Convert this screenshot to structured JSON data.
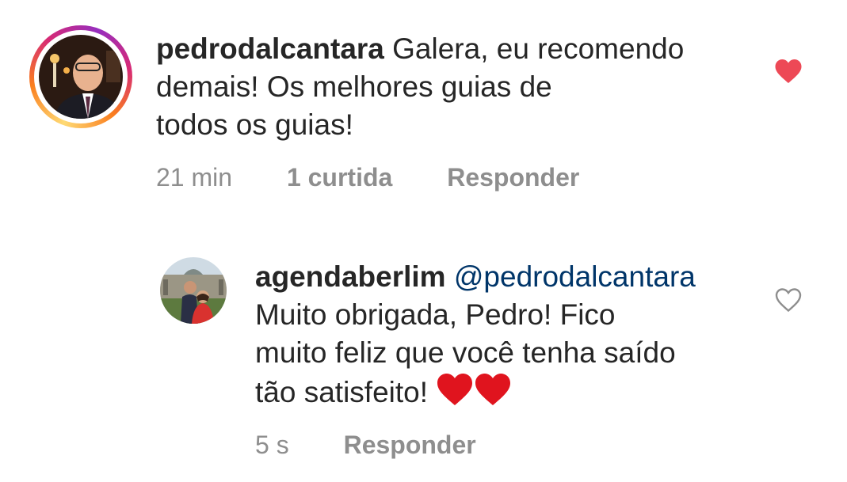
{
  "comments": [
    {
      "username": "pedrodalcantara",
      "text": "Galera, eu recomendo demais! Os melhores guias de todos os guias!",
      "line1": "Galera, eu recomendo",
      "line2": "demais! Os melhores guias de",
      "line3": "todos os guias!",
      "time": "21 min",
      "likes": "1 curtida",
      "reply_label": "Responder",
      "liked": true,
      "like_color": "#ed4956"
    },
    {
      "username": "agendaberlim",
      "mention": "@pedrodalcantara",
      "line1": "Muito obrigada, Pedro! Fico",
      "line2": "muito feliz que você tenha saído",
      "line3": "tão satisfeito!",
      "emoji": "❤❤",
      "time": "5 s",
      "reply_label": "Responder",
      "liked": false
    }
  ],
  "colors": {
    "text": "#262626",
    "meta": "#8e8e8e",
    "mention": "#003569",
    "heart": "#ed4956"
  },
  "icons": [
    "heart-filled-icon",
    "heart-outline-icon"
  ]
}
